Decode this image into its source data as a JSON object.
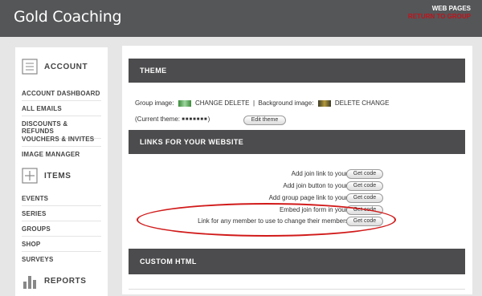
{
  "header": {
    "title": "Gold Coaching",
    "web_pages": "WEB PAGES",
    "return_link": "RETURN TO GROUP"
  },
  "sidebar": {
    "account": {
      "label": "ACCOUNT",
      "items": [
        "ACCOUNT DASHBOARD",
        "ALL EMAILS",
        "DISCOUNTS & REFUNDS",
        "VOUCHERS & INVITES",
        "IMAGE MANAGER"
      ]
    },
    "items_section": {
      "label": "ITEMS",
      "items": [
        "EVENTS",
        "SERIES",
        "GROUPS",
        "SHOP",
        "SURVEYS"
      ]
    },
    "reports": {
      "label": "REPORTS"
    }
  },
  "theme": {
    "title": "THEME",
    "group_image_label": "Group image:",
    "change_delete": "CHANGE DELETE",
    "separator": "|",
    "background_image_label": "Background image:",
    "delete_change": "DELETE CHANGE",
    "current_theme_open": "(Current theme:",
    "current_theme_close": ")",
    "edit_theme": "Edit theme"
  },
  "links": {
    "title": "LINKS FOR YOUR WEBSITE",
    "rows": [
      "Add join link to your website:",
      "Add join button to your website:",
      "Add group page link to your website:",
      "Embed join form in your website:",
      "Link for any member to use to change their membership type:"
    ],
    "button_label": "Get code"
  },
  "custom_html": {
    "title": "CUSTOM HTML"
  },
  "colors": {
    "topbar": "#555658",
    "panel_header": "#4c4c4e",
    "accent_red": "#c0141b"
  }
}
